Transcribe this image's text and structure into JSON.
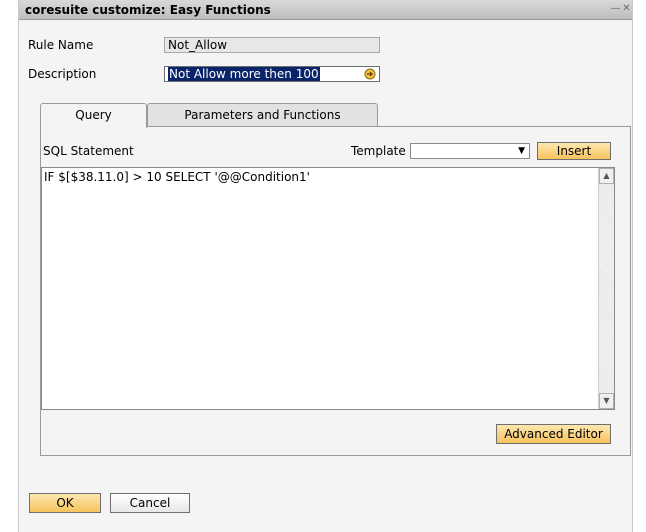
{
  "window": {
    "title": "coresuite customize: Easy Functions"
  },
  "form": {
    "rule_name_label": "Rule Name",
    "rule_name_value": "Not_Allow",
    "description_label": "Description",
    "description_value": "Not Allow more then 100"
  },
  "tabs": [
    {
      "label": "Query",
      "active": true
    },
    {
      "label": "Parameters and Functions",
      "active": false
    }
  ],
  "query": {
    "sql_label": "SQL Statement",
    "template_label": "Template",
    "template_value": "",
    "insert_label": "Insert",
    "sql_text": "IF $[$38.11.0] > 10 SELECT '@@Condition1'",
    "advanced_editor_label": "Advanced Editor"
  },
  "footer": {
    "ok_label": "OK",
    "cancel_label": "Cancel"
  },
  "colors": {
    "selection": "#0a246a",
    "button_orange": "#f7c35c",
    "title_bar": "#bdbdbd"
  }
}
